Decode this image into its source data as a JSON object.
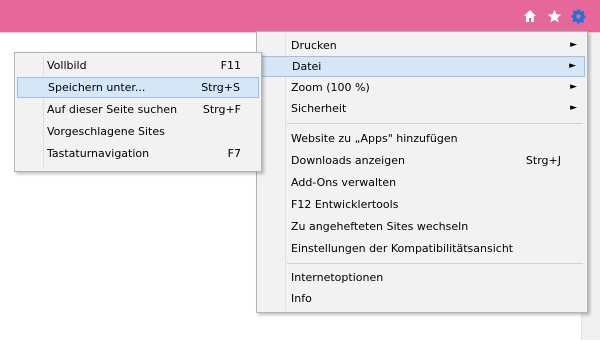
{
  "colors": {
    "titlebar": "#e6679a",
    "menu_bg": "#f2f2f2",
    "highlight": "#d5e6f7",
    "gear": "#1f73d6"
  },
  "toolbar": {
    "icons": [
      "home-icon",
      "favorites-star-icon",
      "tools-gear-icon"
    ]
  },
  "tools_menu": {
    "items": [
      {
        "label": "Drucken",
        "submenu": true
      },
      {
        "label": "Datei",
        "submenu": true,
        "highlighted": true
      },
      {
        "label": "Zoom (100 %)",
        "submenu": true
      },
      {
        "label": "Sicherheit",
        "submenu": true
      },
      {
        "label": "Website zu „Apps\" hinzufügen"
      },
      {
        "label": "Downloads anzeigen",
        "shortcut": "Strg+J"
      },
      {
        "label": "Add-Ons verwalten"
      },
      {
        "label": "F12 Entwicklertools"
      },
      {
        "label": "Zu angehefteten Sites wechseln"
      },
      {
        "label": "Einstellungen der Kompatibilitätsansicht"
      },
      {
        "label": "Internetoptionen"
      },
      {
        "label": "Info"
      }
    ],
    "submenu_arrow": "►"
  },
  "file_menu": {
    "items": [
      {
        "label": "Vollbild",
        "shortcut": "F11"
      },
      {
        "label": "Speichern unter...",
        "shortcut": "Strg+S",
        "highlighted": true
      },
      {
        "label": "Auf dieser Seite suchen",
        "shortcut": "Strg+F"
      },
      {
        "label": "Vorgeschlagene Sites"
      },
      {
        "label": "Tastaturnavigation",
        "shortcut": "F7"
      }
    ]
  }
}
